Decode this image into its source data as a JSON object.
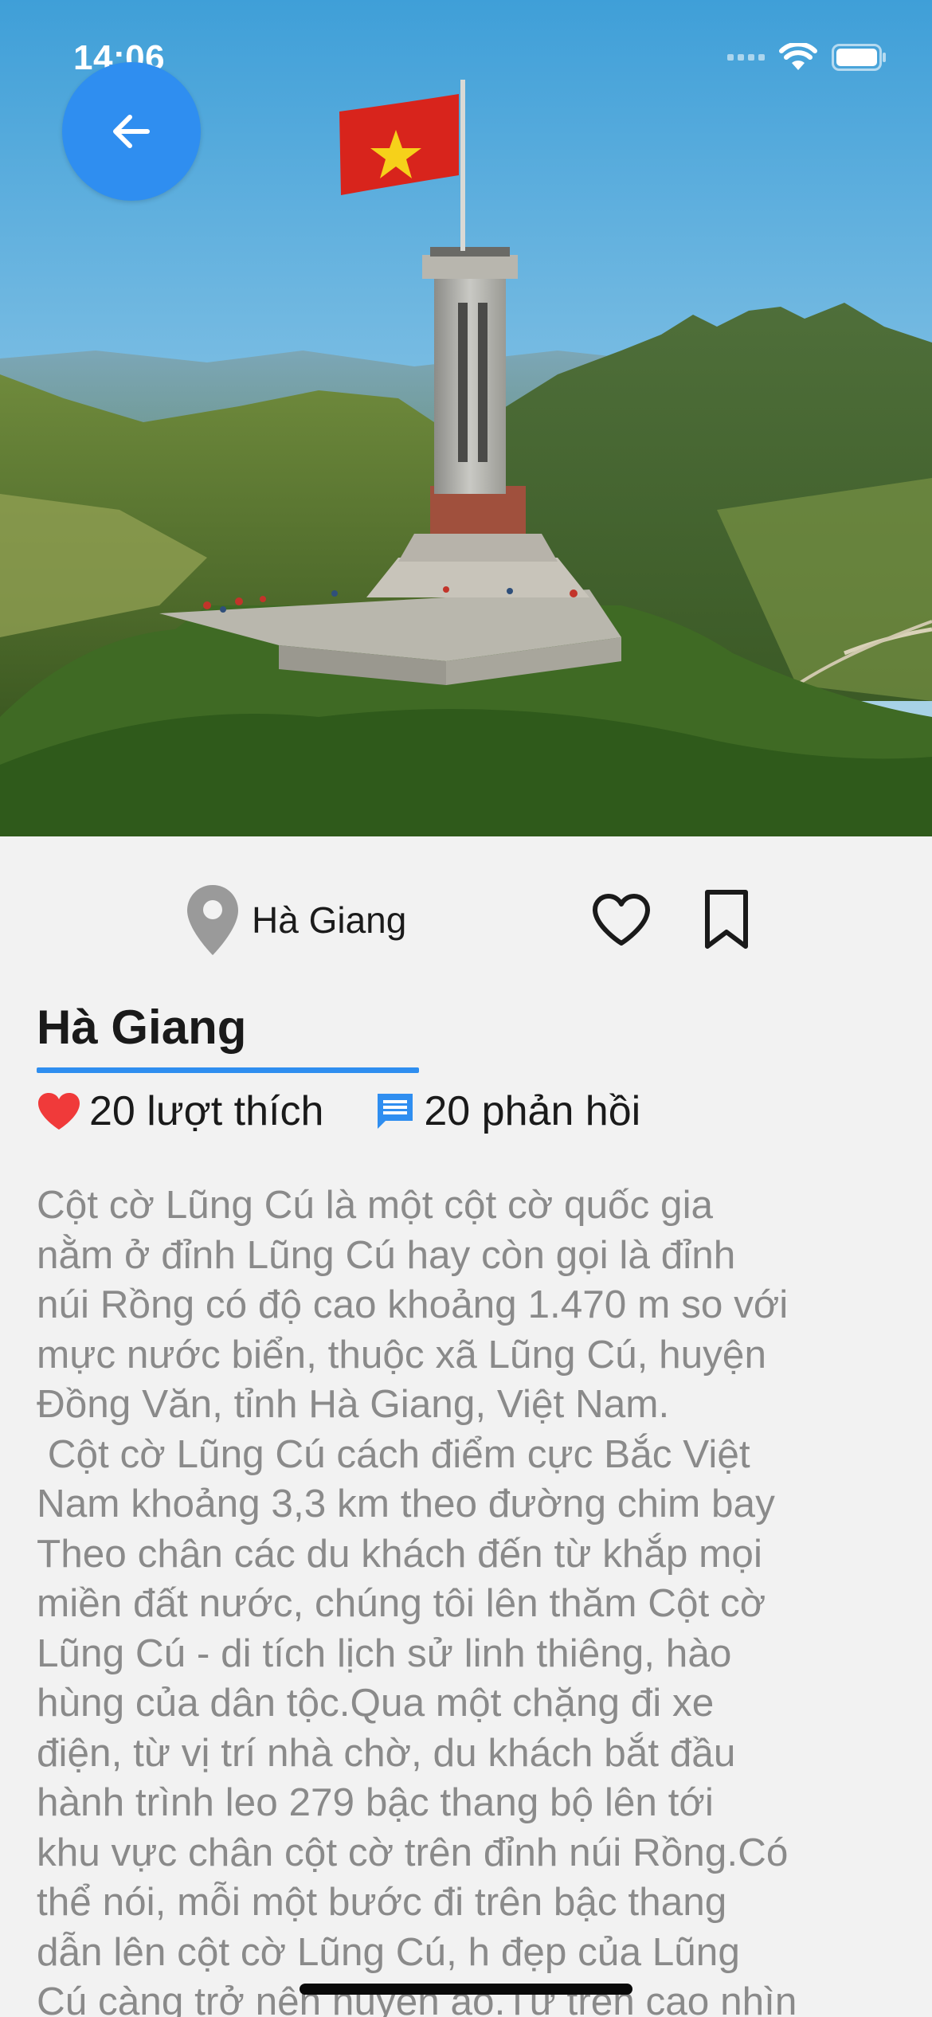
{
  "status_bar": {
    "time": "14:06"
  },
  "hero": {
    "image_subject": "Lung Cu flag tower on mountain with Vietnamese flag"
  },
  "icons": {
    "back": "arrow-left-icon",
    "location": "map-pin-icon",
    "like": "heart-outline-icon",
    "bookmark": "bookmark-outline-icon",
    "likes_stat": "heart-filled-icon",
    "comments_stat": "comment-icon"
  },
  "colors": {
    "accent": "#2f8ef0",
    "heart": "#f03a3a",
    "comment": "#2f8ef0",
    "description_text": "#8a8a8a"
  },
  "location": {
    "label": "Hà Giang"
  },
  "place": {
    "title": "Hà Giang",
    "likes_label": "20 lượt thích",
    "comments_label": "20 phản hồi",
    "description": "Cột cờ Lũng Cú là một cột cờ quốc gia\nnằm ở đỉnh Lũng Cú hay còn gọi là đỉnh\nnúi Rồng có độ cao khoảng 1.470 m so với\nmực nước biển, thuộc xã Lũng Cú, huyện\nĐồng Văn, tỉnh Hà Giang, Việt Nam.\n Cột cờ Lũng Cú cách điểm cực Bắc Việt\nNam khoảng 3,3 km theo đường chim bay\nTheo chân các du khách đến từ khắp mọi\nmiền đất nước, chúng tôi lên thăm Cột cờ\nLũng Cú - di tích lịch sử linh thiêng, hào\nhùng của dân tộc.Qua một chặng đi xe\nđiện, từ vị trí nhà chờ, du khách bắt đầu\nhành trình leo 279 bậc thang bộ lên tới\nkhu vực chân cột cờ trên đỉnh núi Rồng.Có\nthể nói, mỗi một bước đi trên bậc thang\ndẫn lên cột cờ Lũng Cú, h đẹp của Lũng\nCú càng trở nên huyền ảo.Từ trên cao nhìn"
  }
}
